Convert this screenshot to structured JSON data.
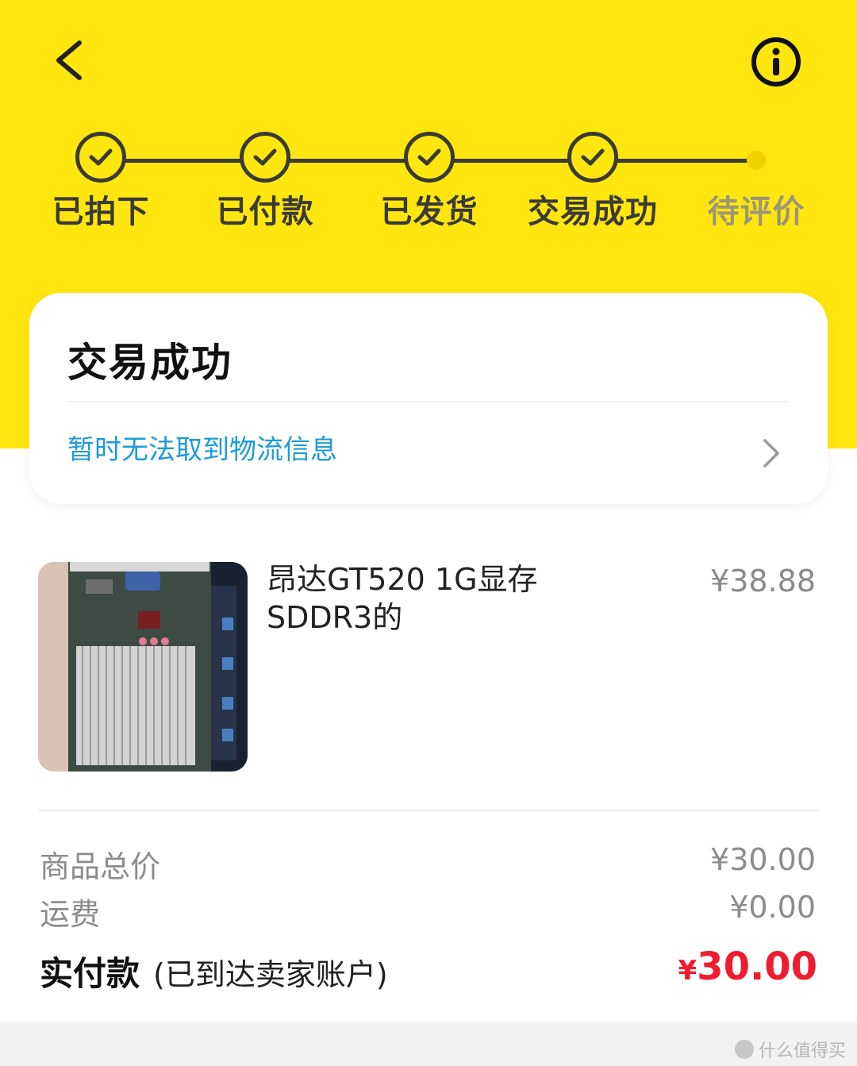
{
  "header": {
    "back_icon": "chevron-left-icon",
    "info_icon": "info-icon"
  },
  "progress": {
    "steps": [
      {
        "label": "已拍下",
        "status": "done"
      },
      {
        "label": "已付款",
        "status": "done"
      },
      {
        "label": "已发货",
        "status": "done"
      },
      {
        "label": "交易成功",
        "status": "done"
      },
      {
        "label": "待评价",
        "status": "pending"
      }
    ]
  },
  "status_card": {
    "title": "交易成功",
    "logistics_text": "暂时无法取到物流信息"
  },
  "product": {
    "title": "昂达GT520 1G显存SDDR3的",
    "price": "¥38.88"
  },
  "summary": {
    "goods_total_label": "商品总价",
    "goods_total_value": "¥30.00",
    "shipping_label": "运费",
    "shipping_value": "¥0.00",
    "paid_label": "实付款",
    "paid_note": "(已到达卖家账户)",
    "paid_currency": "¥",
    "paid_amount": "30.00"
  },
  "watermark": {
    "text": "什么值得买"
  },
  "colors": {
    "header_yellow": "#ffe60f",
    "step_dark": "#3a3a36",
    "step_pending": "#9c9676",
    "link_blue": "#1d9bd8",
    "price_red": "#ee1c2e"
  }
}
